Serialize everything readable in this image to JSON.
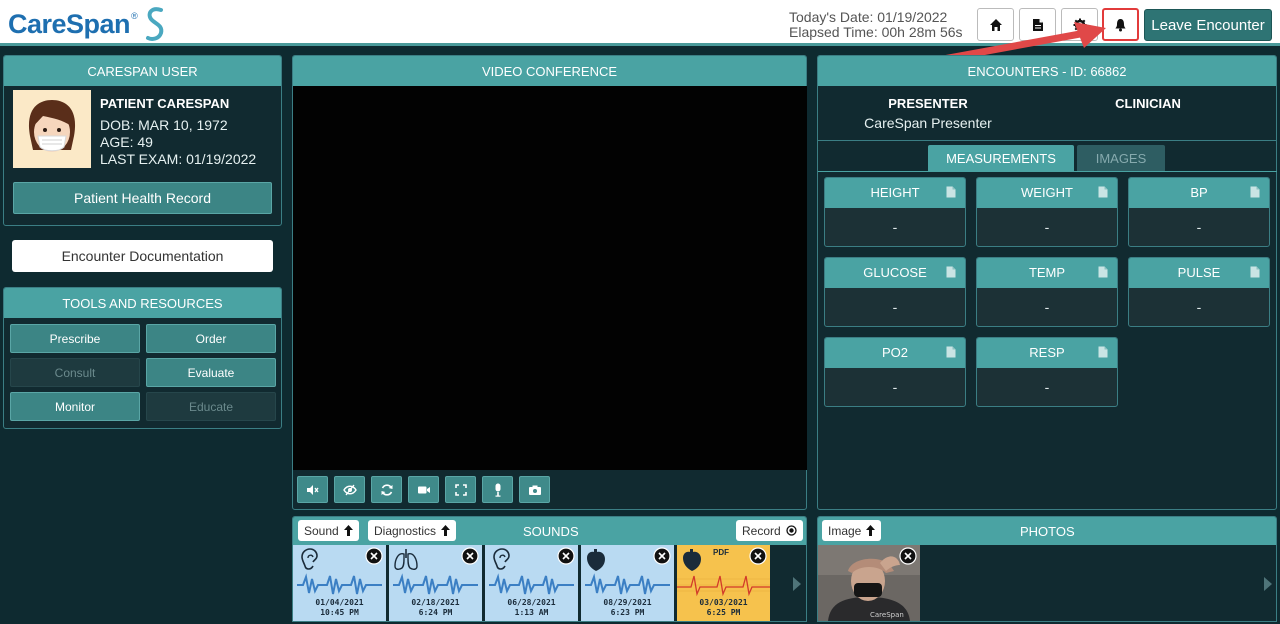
{
  "header": {
    "brand": "CareSpan",
    "brand_tm": "®",
    "today_date": "Today's Date: 01/19/2022",
    "elapsed_time": "Elapsed Time: 00h 28m 56s",
    "buttons": {
      "home": "home-icon",
      "document": "document-icon",
      "settings": "gear-icon",
      "notifications": "bell-icon"
    },
    "leave_label": "Leave Encounter"
  },
  "user_panel": {
    "title": "CARESPAN USER",
    "patient_name": "PATIENT CARESPAN",
    "dob": "DOB: MAR 10, 1972",
    "age": "AGE: 49",
    "last_exam": "LAST EXAM: 01/19/2022",
    "phr_label": "Patient Health Record"
  },
  "encounter_doc_label": "Encounter Documentation",
  "tools": {
    "title": "TOOLS AND RESOURCES",
    "items": [
      {
        "label": "Prescribe",
        "enabled": true
      },
      {
        "label": "Order",
        "enabled": true
      },
      {
        "label": "Consult",
        "enabled": false
      },
      {
        "label": "Evaluate",
        "enabled": true
      },
      {
        "label": "Monitor",
        "enabled": true
      },
      {
        "label": "Educate",
        "enabled": false
      }
    ]
  },
  "video": {
    "title": "VIDEO CONFERENCE",
    "controls": [
      "mute-icon",
      "hide-video-icon",
      "switch-camera-icon",
      "camera-icon",
      "fullscreen-icon",
      "microphone-icon",
      "snapshot-icon"
    ]
  },
  "encounter": {
    "title": "ENCOUNTERS - ID: 66862",
    "presenter_label": "PRESENTER",
    "presenter_name": "CareSpan Presenter",
    "clinician_label": "CLINICIAN",
    "tabs": {
      "measurements": "MEASUREMENTS",
      "images": "IMAGES"
    },
    "measurements": [
      {
        "label": "HEIGHT",
        "value": "-"
      },
      {
        "label": "WEIGHT",
        "value": "-"
      },
      {
        "label": "BP",
        "value": "-"
      },
      {
        "label": "GLUCOSE",
        "value": "-"
      },
      {
        "label": "TEMP",
        "value": "-"
      },
      {
        "label": "PULSE",
        "value": "-"
      },
      {
        "label": "PO2",
        "value": "-"
      },
      {
        "label": "RESP",
        "value": "-"
      }
    ]
  },
  "sounds": {
    "title": "SOUNDS",
    "sound_chip": "Sound",
    "diagnostics_chip": "Diagnostics",
    "record_chip": "Record",
    "items": [
      {
        "icon": "ear-icon",
        "date": "01/04/2021",
        "time": "10:45 PM"
      },
      {
        "icon": "lungs-icon",
        "date": "02/18/2021",
        "time": "6:24 PM"
      },
      {
        "icon": "ear-icon",
        "date": "06/28/2021",
        "time": "1:13 AM"
      },
      {
        "icon": "heart-icon",
        "date": "08/29/2021",
        "time": "6:23 PM"
      },
      {
        "icon": "heart-icon",
        "tag": "PDF",
        "date": "03/03/2021",
        "time": "6:25 PM"
      }
    ]
  },
  "photos": {
    "title": "PHOTOS",
    "image_chip": "Image"
  }
}
